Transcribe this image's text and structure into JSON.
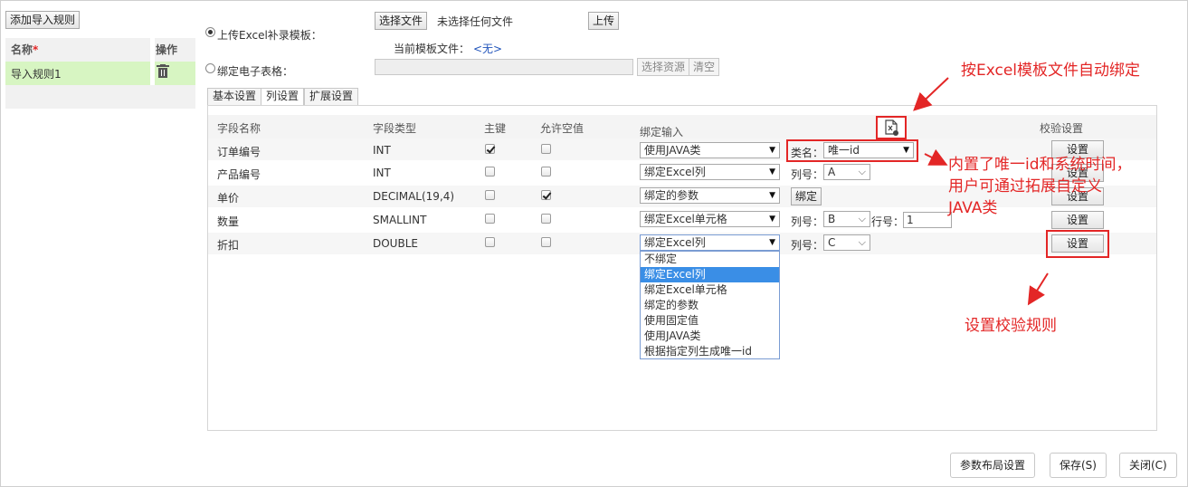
{
  "left_panel": {
    "add_rule_button": "添加导入规则",
    "col_name": "名称",
    "required_mark": "*",
    "col_action": "操作",
    "rules": [
      {
        "name": "导入规则1"
      }
    ]
  },
  "source": {
    "upload_label": "上传Excel补录模板：",
    "bind_label": "绑定电子表格：",
    "choose_file_button": "选择文件",
    "no_file_text": "未选择任何文件",
    "upload_button": "上传",
    "current_template_label": "当前模板文件：",
    "current_template_value": "<无>",
    "select_resource_button": "选择资源",
    "clear_button": "清空"
  },
  "tabs": [
    "基本设置",
    "列设置",
    "扩展设置"
  ],
  "grid": {
    "headers": {
      "field_name": "字段名称",
      "field_type": "字段类型",
      "primary_key": "主键",
      "allow_null": "允许空值",
      "bind_input": "绑定输入",
      "validation": "校验设置"
    },
    "rows": [
      {
        "name": "订单编号",
        "type": "INT",
        "pk": true,
        "nullable": false,
        "bind": "使用JAVA类",
        "extra_label": "类名：",
        "extra_value": "唯一id",
        "action": "设置"
      },
      {
        "name": "产品编号",
        "type": "INT",
        "pk": false,
        "nullable": false,
        "bind": "绑定Excel列",
        "extra_label": "列号：",
        "extra_value": "A",
        "action": "设置"
      },
      {
        "name": "单价",
        "type": "DECIMAL(19,4)",
        "pk": false,
        "nullable": true,
        "bind": "绑定的参数",
        "extra_button": "绑定",
        "action": "设置"
      },
      {
        "name": "数量",
        "type": "SMALLINT",
        "pk": false,
        "nullable": false,
        "bind": "绑定Excel单元格",
        "extra_label": "列号：",
        "extra_value": "B",
        "extra_label2": "行号：",
        "extra_value2": "1",
        "action": "设置"
      },
      {
        "name": "折扣",
        "type": "DOUBLE",
        "pk": false,
        "nullable": false,
        "bind": "绑定Excel列",
        "extra_label": "列号：",
        "extra_value": "C",
        "action": "设置"
      }
    ],
    "dropdown_options": [
      "不绑定",
      "绑定Excel列",
      "绑定Excel单元格",
      "绑定的参数",
      "使用固定值",
      "使用JAVA类",
      "根据指定列生成唯一id"
    ],
    "dropdown_selected": "绑定Excel列"
  },
  "annotations": {
    "auto_bind": "按Excel模板文件自动绑定",
    "builtin_line1": "内置了唯一id和系统时间，",
    "builtin_line2": "用户可通过拓展自定义",
    "builtin_line3": "JAVA类",
    "validation_rule": "设置校验规则"
  },
  "footer": {
    "layout_button": "参数布局设置",
    "save_button": "保存(S)",
    "close_button": "关闭(C)"
  },
  "colors": {
    "accent_red": "#e32626",
    "selected_row": "#d7f5c2",
    "dropdown_highlight": "#3a8ee6",
    "link_blue": "#2255bb"
  }
}
